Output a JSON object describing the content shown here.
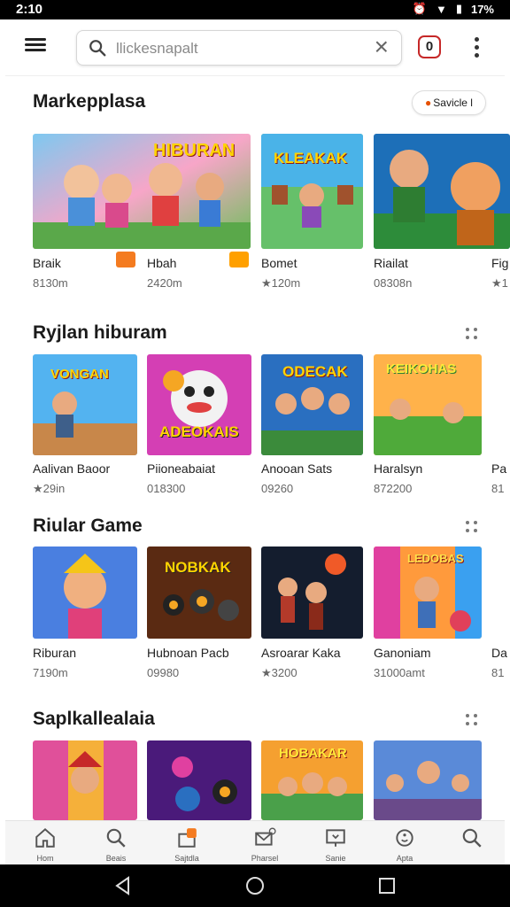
{
  "status_bar": {
    "time": "2:10",
    "battery": "17%"
  },
  "search": {
    "placeholder": "llickesnapalt"
  },
  "notifications": {
    "count": "0"
  },
  "sections": [
    {
      "title": "Markepplasa",
      "action_chip": "Savicle l",
      "items": [
        {
          "name": "Braik",
          "meta": "8130m",
          "badge_color": "#f47b20"
        },
        {
          "name": "Hbah",
          "meta": "2420m",
          "badge_color": "#ffa000"
        },
        {
          "name": "Bomet",
          "meta": "★120m"
        },
        {
          "name": "Riailat",
          "meta": "08308n"
        },
        {
          "name": "Fig",
          "meta": "★1"
        }
      ],
      "tile_texts": [
        "HIBURAN",
        "KLEAKAK",
        "",
        ""
      ]
    },
    {
      "title": "Ryjlan hiburam",
      "items": [
        {
          "name": "Aalivan Baoor",
          "meta": "★29in"
        },
        {
          "name": "Piioneabaiat",
          "meta": "018300"
        },
        {
          "name": "Anooan Sats",
          "meta": "09260"
        },
        {
          "name": "Haralsyn",
          "meta": "872200"
        },
        {
          "name": "Pa",
          "meta": "81"
        }
      ],
      "tile_texts": [
        "VONGAN",
        "ADEOKAIS",
        "ODECAK",
        "KEIKOHAS"
      ]
    },
    {
      "title": "Riular Game",
      "items": [
        {
          "name": "Riburan",
          "meta": "7190m"
        },
        {
          "name": "Hubnoan Pacb",
          "meta": "09980"
        },
        {
          "name": "Asroarar Kaka",
          "meta": "★3200"
        },
        {
          "name": "Ganoniam",
          "meta": "31000amt"
        },
        {
          "name": "Da",
          "meta": "81"
        }
      ],
      "tile_texts": [
        "",
        "NOBKAK",
        "",
        "LEDOBAS"
      ]
    },
    {
      "title": "Saplkallealaia",
      "items": [],
      "tile_texts": [
        "",
        "",
        "HOBAKAR",
        ""
      ]
    }
  ],
  "bottom_nav": [
    {
      "label": "Hom",
      "icon": "home-icon"
    },
    {
      "label": "Beais",
      "icon": "search-icon"
    },
    {
      "label": "Sajtdla",
      "icon": "gift-icon"
    },
    {
      "label": "Pharsel",
      "icon": "mail-icon"
    },
    {
      "label": "Sanie",
      "icon": "download-icon"
    },
    {
      "label": "Apta",
      "icon": "smile-icon"
    },
    {
      "label": "",
      "icon": "search-icon"
    }
  ],
  "colors": {
    "accent": "#f47b20",
    "notif_border": "#c62828"
  }
}
